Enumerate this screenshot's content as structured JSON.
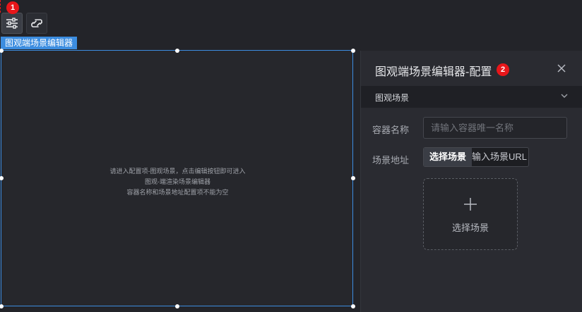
{
  "toolbar": {
    "config_badge": "1",
    "panel_badge": "2",
    "config_icon": "sliders-icon",
    "other_icon": "link-refresh-icon"
  },
  "canvas": {
    "component_label": "图观端场景编辑器",
    "hint_lines": [
      "请进入配置项-图观场景，点击编辑按钮即可进入",
      "图观-端渲染场景编辑器",
      "容器名称和场景地址配置项不能为空"
    ]
  },
  "panel": {
    "title": "图观端场景编辑器-配置",
    "close_icon": "close-icon",
    "section_title": "图观场景",
    "container_name_label": "容器名称",
    "container_name_placeholder": "请输入容器唯一名称",
    "container_name_value": "",
    "scene_address_label": "场景地址",
    "scene_tabs": [
      "选择场景",
      "输入场景URL"
    ],
    "upload_label": "选择场景"
  },
  "colors": {
    "accent": "#3c8de0",
    "badge": "#e8161a",
    "background": "#232429",
    "panel": "#2a2b31"
  }
}
